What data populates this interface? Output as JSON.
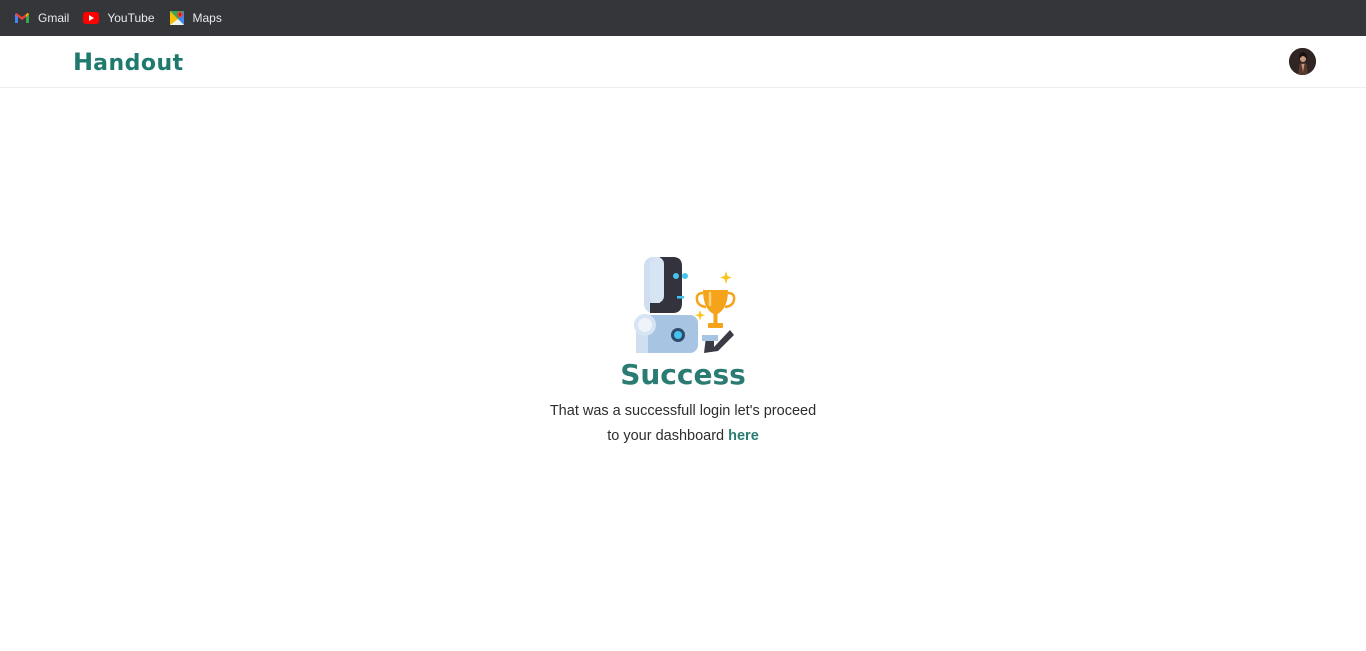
{
  "bookmarks": [
    {
      "label": "Gmail",
      "icon": "gmail-icon"
    },
    {
      "label": "YouTube",
      "icon": "youtube-icon"
    },
    {
      "label": "Maps",
      "icon": "maps-icon"
    }
  ],
  "navbar": {
    "logo_first": "H",
    "logo_rest": "andout",
    "avatar_icon": "user-avatar"
  },
  "main": {
    "illustration_icon": "robot-trophy-icon",
    "title": "Success",
    "message_line1": "That was a successfull login let's proceed",
    "message_line2": "to your dashboard ",
    "link_label": "here"
  },
  "colors": {
    "bookmark_bar": "#35363a",
    "brand": "#1e7a6d",
    "title": "#2a7c72"
  }
}
